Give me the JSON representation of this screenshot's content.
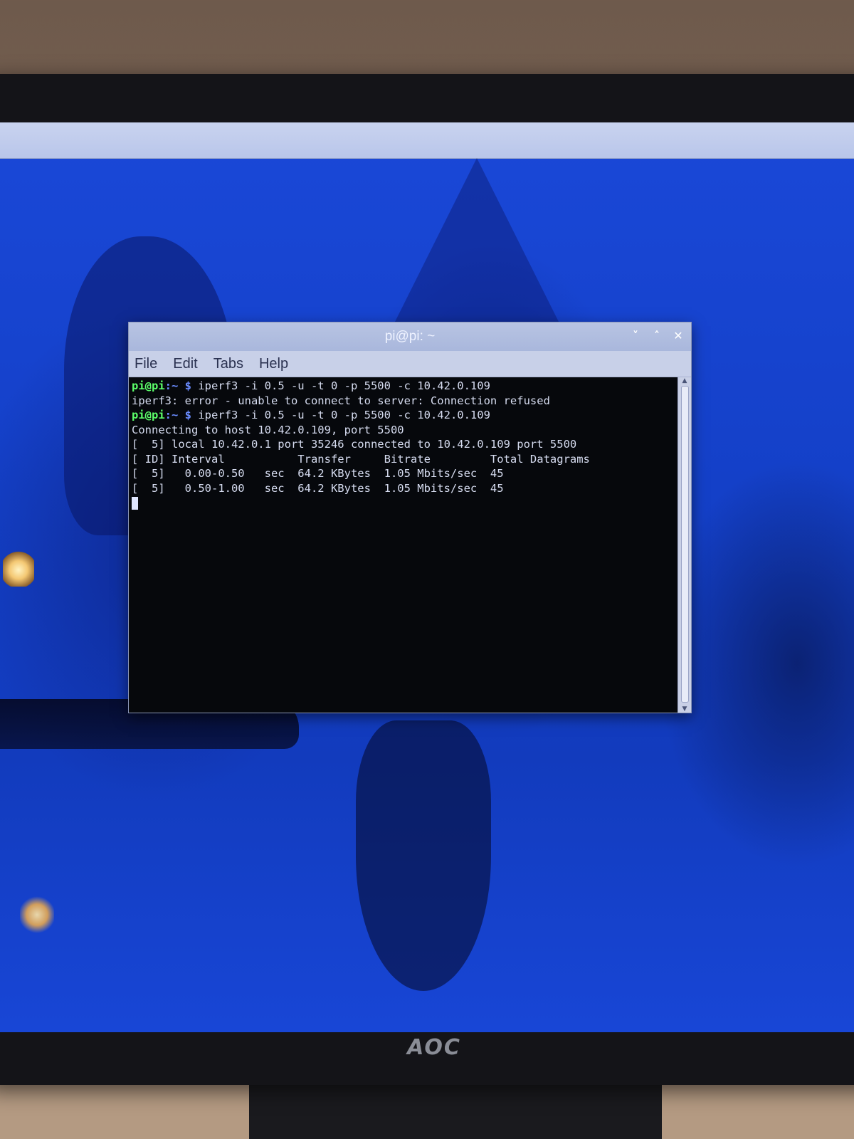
{
  "window": {
    "title": "pi@pi: ~",
    "controls": [
      "˅",
      "˄",
      "✕"
    ]
  },
  "menubar": {
    "items": [
      "File",
      "Edit",
      "Tabs",
      "Help"
    ]
  },
  "terminal": {
    "prompt_user": "pi@pi",
    "prompt_path": ":~ $",
    "commands": [
      " iperf3 -i 0.5 -u -t 0 -p 5500 -c 10.42.0.109",
      " iperf3 -i 0.5 -u -t 0 -p 5500 -c 10.42.0.109"
    ],
    "error_line": "iperf3: error - unable to connect to server: Connection refused",
    "connecting_line": "Connecting to host 10.42.0.109, port 5500",
    "local_line": "[  5] local 10.42.0.1 port 35246 connected to 10.42.0.109 port 5500",
    "header_line": "[ ID] Interval           Transfer     Bitrate         Total Datagrams",
    "rows": [
      "[  5]   0.00-0.50   sec  64.2 KBytes  1.05 Mbits/sec  45",
      "[  5]   0.50-1.00   sec  64.2 KBytes  1.05 Mbits/sec  45"
    ]
  },
  "monitor": {
    "brand": "AOC"
  },
  "colors": {
    "prompt_user": "#5cff6a",
    "prompt_path": "#6a8cff",
    "terminal_bg": "#06080c",
    "desktop_blue": "#1440c8"
  }
}
